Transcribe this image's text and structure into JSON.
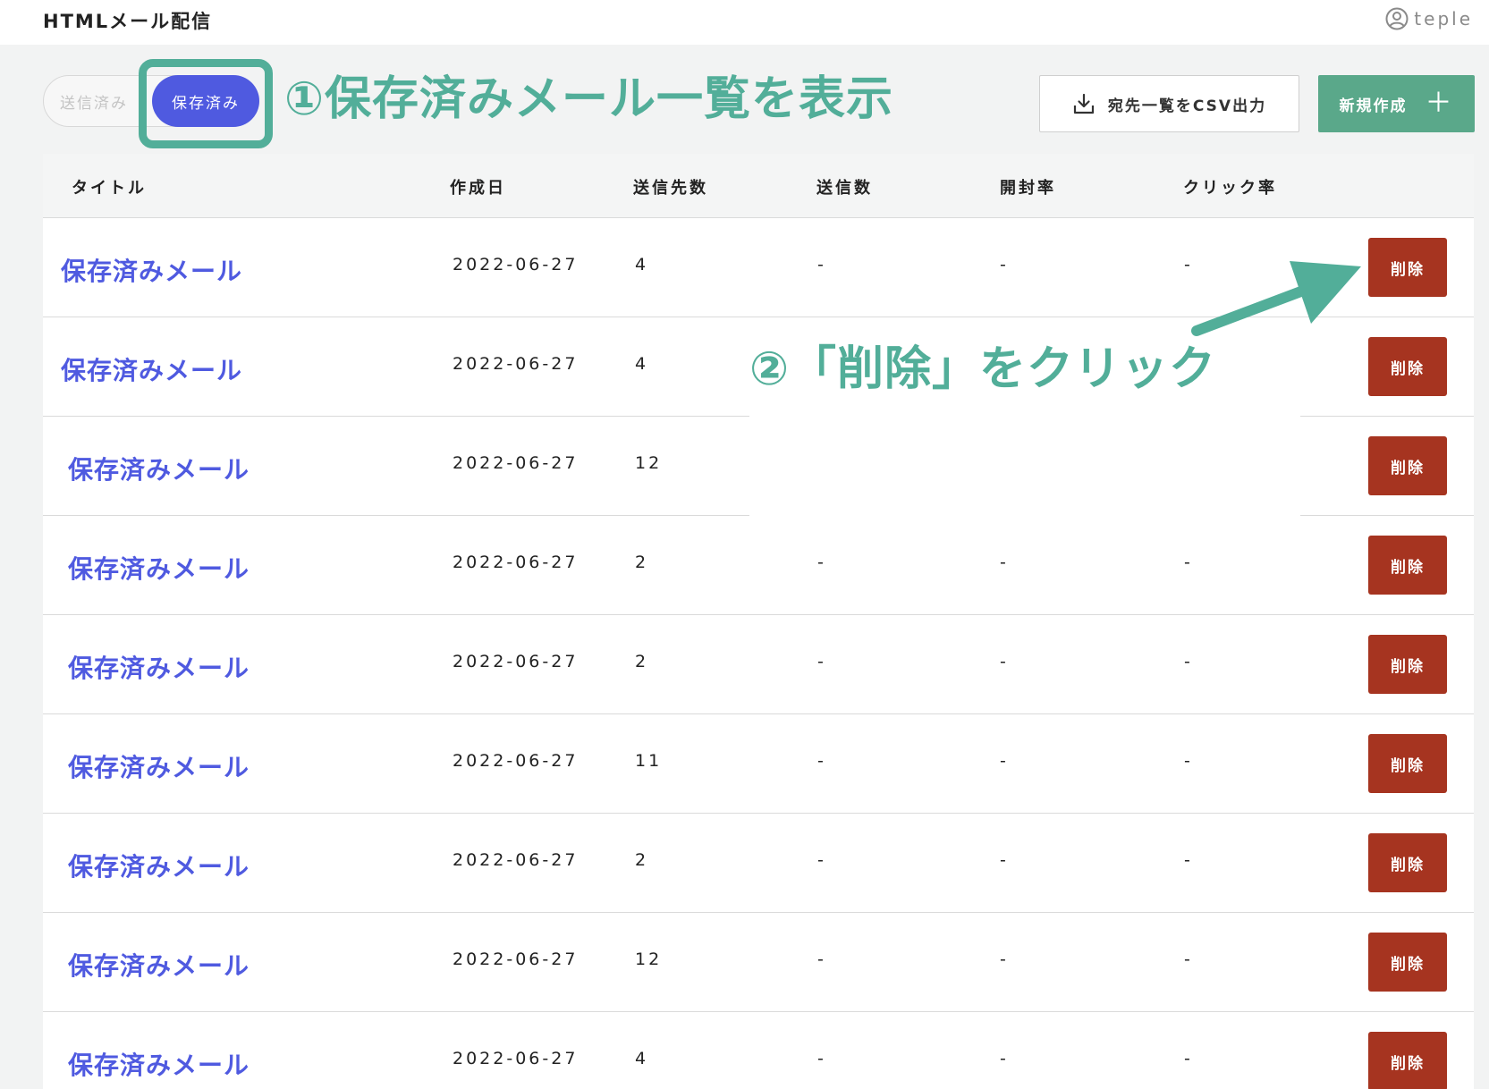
{
  "app": {
    "title": "HTMLメール配信",
    "brand": "teple"
  },
  "toggle": {
    "sent_label": "送信済み",
    "saved_label": "保存済み"
  },
  "annotations": {
    "step1": "①保存済みメール一覧を表示",
    "step2": "②「削除」をクリック"
  },
  "toolbar": {
    "csv_label": "宛先一覧をCSV出力",
    "new_label": "新規作成",
    "new_icon": "plus-icon"
  },
  "colors": {
    "accent": "#4f5ae0",
    "annotation": "#52ae99",
    "delete": "#a63420",
    "new": "#5aa88a"
  },
  "table": {
    "headers": [
      "タイトル",
      "作成日",
      "送信先数",
      "送信数",
      "開封率",
      "クリック率"
    ],
    "delete_label": "削除",
    "rows": [
      {
        "title": "保存済みメール",
        "date": "2022-06-27",
        "recipients": "4",
        "sent": "-",
        "open": "-",
        "click": "-"
      },
      {
        "title": "保存済みメール",
        "date": "2022-06-27",
        "recipients": "4",
        "sent": "",
        "open": "",
        "click": ""
      },
      {
        "title": "保存済みメール",
        "date": "2022-06-27",
        "recipients": "12",
        "sent": "",
        "open": "",
        "click": ""
      },
      {
        "title": "保存済みメール",
        "date": "2022-06-27",
        "recipients": "2",
        "sent": "-",
        "open": "-",
        "click": "-"
      },
      {
        "title": "保存済みメール",
        "date": "2022-06-27",
        "recipients": "2",
        "sent": "-",
        "open": "-",
        "click": "-"
      },
      {
        "title": "保存済みメール",
        "date": "2022-06-27",
        "recipients": "11",
        "sent": "-",
        "open": "-",
        "click": "-"
      },
      {
        "title": "保存済みメール",
        "date": "2022-06-27",
        "recipients": "2",
        "sent": "-",
        "open": "-",
        "click": "-"
      },
      {
        "title": "保存済みメール",
        "date": "2022-06-27",
        "recipients": "12",
        "sent": "-",
        "open": "-",
        "click": "-"
      },
      {
        "title": "保存済みメール",
        "date": "2022-06-27",
        "recipients": "4",
        "sent": "-",
        "open": "-",
        "click": "-"
      }
    ]
  }
}
